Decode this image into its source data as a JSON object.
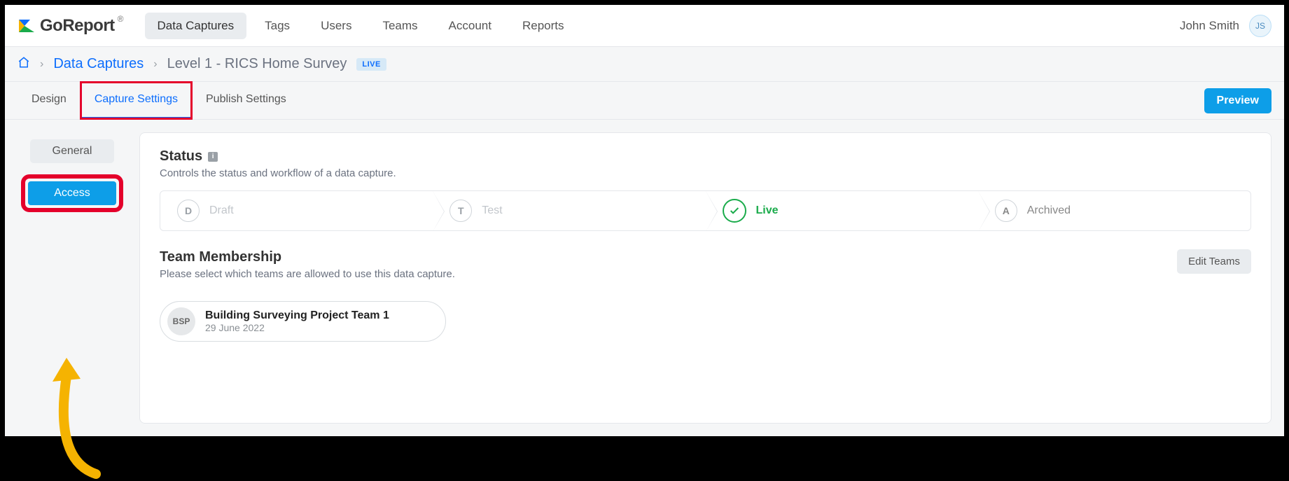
{
  "brand": {
    "name": "GoReport"
  },
  "nav": {
    "items": [
      {
        "label": "Data Captures",
        "active": true
      },
      {
        "label": "Tags"
      },
      {
        "label": "Users"
      },
      {
        "label": "Teams"
      },
      {
        "label": "Account"
      },
      {
        "label": "Reports"
      }
    ]
  },
  "user": {
    "name": "John Smith",
    "initials": "JS"
  },
  "breadcrumb": {
    "link": "Data Captures",
    "current": "Level 1 - RICS Home Survey",
    "badge": "LIVE"
  },
  "tabs": {
    "items": [
      {
        "label": "Design"
      },
      {
        "label": "Capture Settings",
        "active": true,
        "highlight": true
      },
      {
        "label": "Publish Settings"
      }
    ],
    "preview": "Preview"
  },
  "sidebar": {
    "general": "General",
    "access": "Access"
  },
  "status": {
    "title": "Status",
    "desc": "Controls the status and workflow of a data capture.",
    "steps": [
      {
        "code": "D",
        "label": "Draft"
      },
      {
        "code": "T",
        "label": "Test"
      },
      {
        "code": "✓",
        "label": "Live",
        "live": true
      },
      {
        "code": "A",
        "label": "Archived",
        "arch": true
      }
    ]
  },
  "teams": {
    "title": "Team Membership",
    "desc": "Please select which teams are allowed to use this data capture.",
    "edit": "Edit Teams",
    "list": [
      {
        "initials": "BSP",
        "name": "Building Surveying Project Team 1",
        "date": "29 June 2022"
      }
    ]
  }
}
